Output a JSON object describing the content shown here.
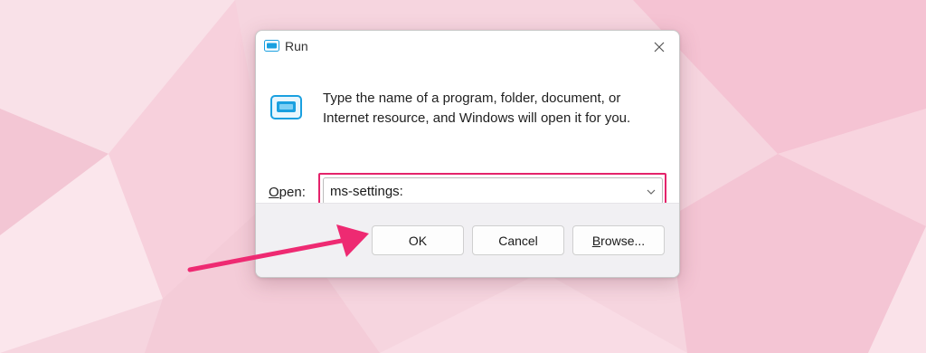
{
  "window": {
    "title": "Run",
    "close_icon": "close-icon",
    "title_icon": "run-app-icon"
  },
  "content": {
    "description": "Type the name of a program, folder, document, or Internet resource, and Windows will open it for you.",
    "open_label_mnemonic": "O",
    "open_label_rest": "pen:",
    "open_value": "ms-settings:",
    "dropdown_icon": "chevron-down-icon"
  },
  "buttons": {
    "ok": "OK",
    "cancel": "Cancel",
    "browse_mnemonic": "B",
    "browse_rest": "rowse..."
  },
  "annotations": {
    "highlight_color": "#e4236b",
    "arrow_color": "#ee2a72",
    "arrow_target": "ok-button"
  },
  "colors": {
    "background": "#f6d6e0",
    "dialog_bg": "#ffffff",
    "footer_bg": "#f1f0f3",
    "icon_accent": "#1aa0e0"
  }
}
